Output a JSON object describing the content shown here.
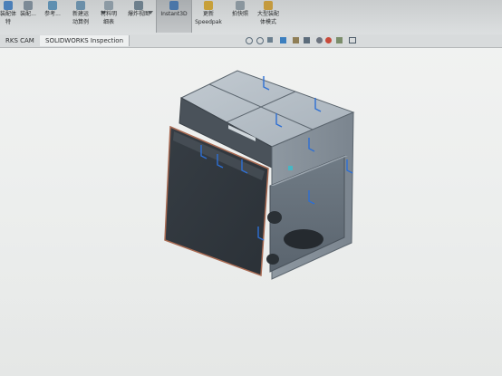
{
  "ribbon": {
    "items": [
      {
        "label": "装配体",
        "sub": "特",
        "icon": "assembly-icon"
      },
      {
        "label": "装配...",
        "sub": "",
        "icon": "mate-icon"
      },
      {
        "label": "参考...",
        "sub": "",
        "icon": "reference-geometry-icon"
      },
      {
        "label": "新建运",
        "sub": "动算例",
        "icon": "new-motion-study-icon"
      },
      {
        "label": "材料明",
        "sub": "细表",
        "icon": "bill-of-materials-icon"
      },
      {
        "label": "爆炸视图",
        "sub": "",
        "icon": "exploded-view-icon"
      },
      {
        "label": "Instant3D",
        "sub": "",
        "icon": "instant3d-icon"
      },
      {
        "label": "更新",
        "sub": "Speedpak",
        "icon": "speedpak-icon"
      },
      {
        "label": "拍快照",
        "sub": "",
        "icon": "snapshot-icon"
      },
      {
        "label": "大型装配",
        "sub": "体模式",
        "icon": "large-assembly-icon"
      }
    ]
  },
  "tabs": [
    {
      "label": "RKS CAM"
    },
    {
      "label": "SOLIDWORKS Inspection"
    }
  ],
  "view_toolbar": [
    "zoom-to-fit-icon",
    "zoom-area-icon",
    "previous-view-icon",
    "section-view-icon",
    "view-orientation-icon",
    "display-style-icon",
    "hide-show-icon",
    "appearance-icon",
    "scene-icon",
    "view-settings-icon",
    "monitor-icon"
  ],
  "colors": {
    "selection_edge": "#a86a52",
    "annotation_blue": "#2d6fd4",
    "model_top": "#b3bcc4",
    "model_dark_face": "#3a4148"
  }
}
